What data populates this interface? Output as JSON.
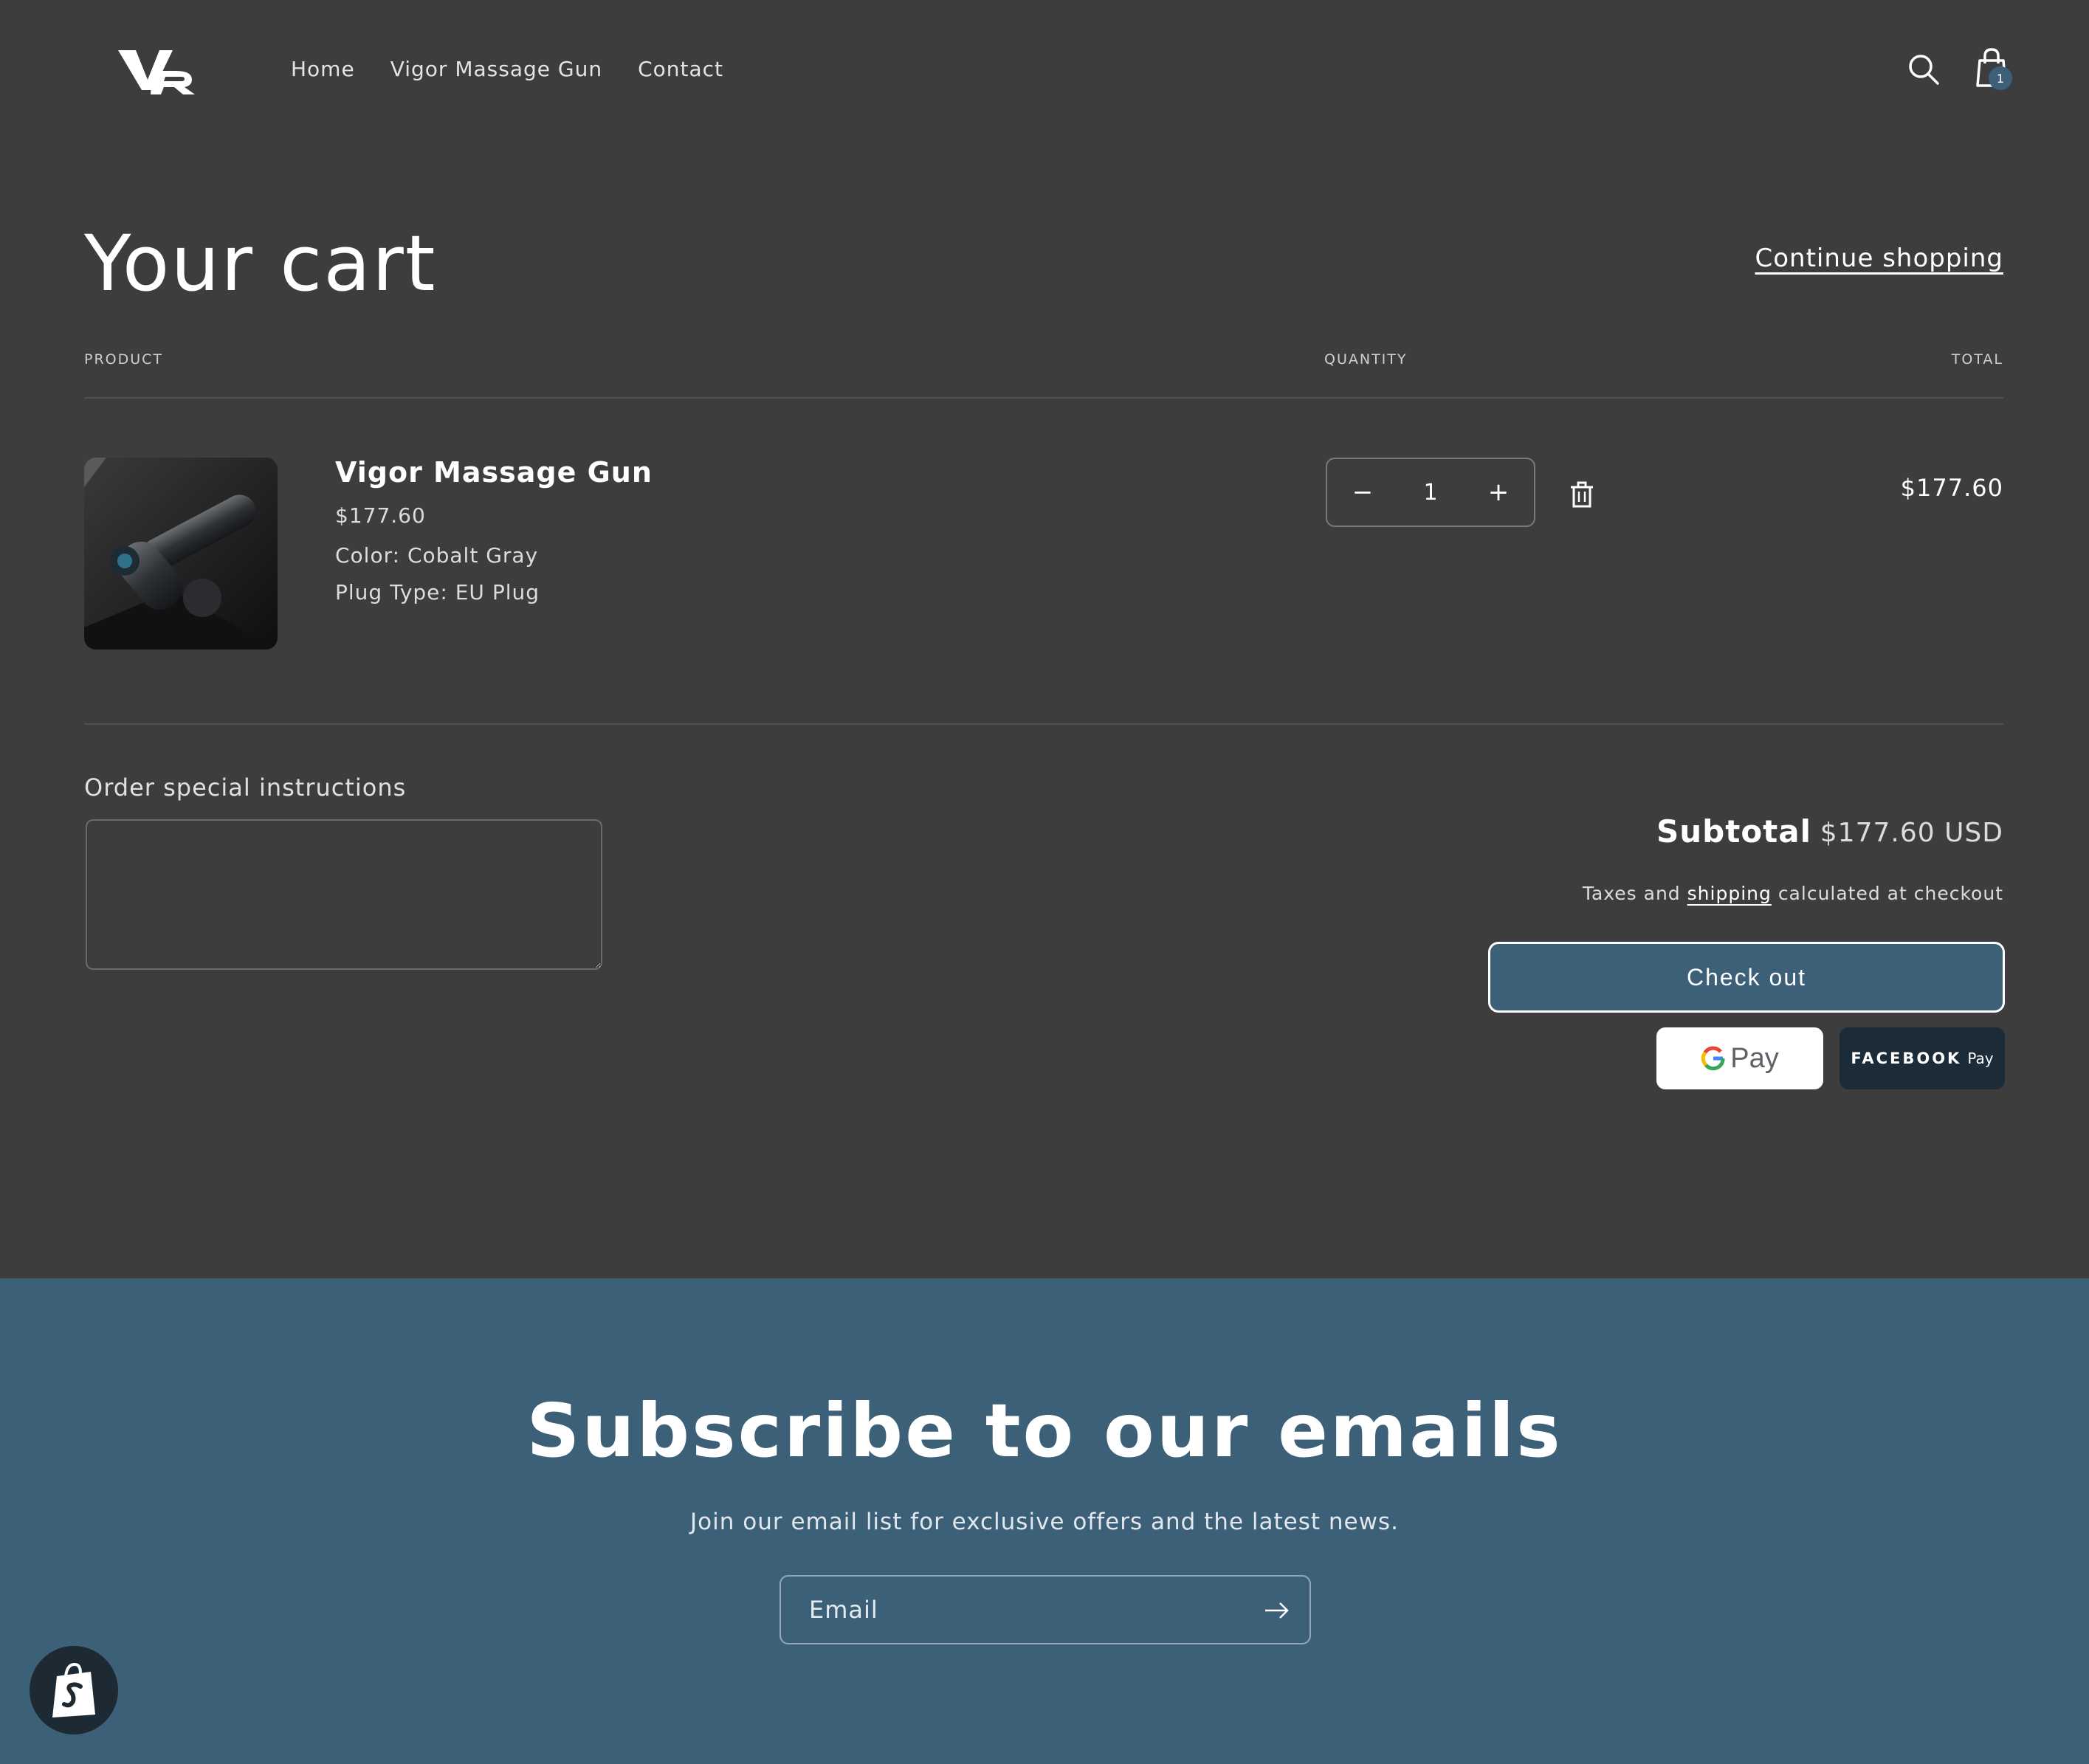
{
  "header": {
    "logo_alt": "VR",
    "nav": [
      "Home",
      "Vigor Massage Gun",
      "Contact"
    ],
    "cart_count": "1"
  },
  "cart": {
    "title": "Your cart",
    "continue_label": "Continue shopping",
    "columns": {
      "product": "PRODUCT",
      "quantity": "QUANTITY",
      "total": "TOTAL"
    },
    "item": {
      "name": "Vigor Massage Gun",
      "price": "$177.60",
      "options": [
        "Color: Cobalt Gray",
        "Plug Type: EU Plug"
      ],
      "quantity": "1",
      "line_total": "$177.60"
    },
    "instructions_label": "Order special instructions",
    "subtotal_label": "Subtotal",
    "subtotal_value": "$177.60 USD",
    "tax_note_pre": "Taxes and",
    "tax_note_link": "shipping",
    "tax_note_post": "calculated at checkout",
    "checkout_label": "Check out",
    "gpay_label": "Pay",
    "fbpay_brand": "FACEBOOK",
    "fbpay_label": "Pay"
  },
  "newsletter": {
    "title": "Subscribe to our emails",
    "subtitle": "Join our email list for exclusive offers and the latest news.",
    "email_placeholder": "Email"
  },
  "colors": {
    "background": "#3d3d3d",
    "accent": "#3d6079",
    "text": "#ffffff"
  }
}
